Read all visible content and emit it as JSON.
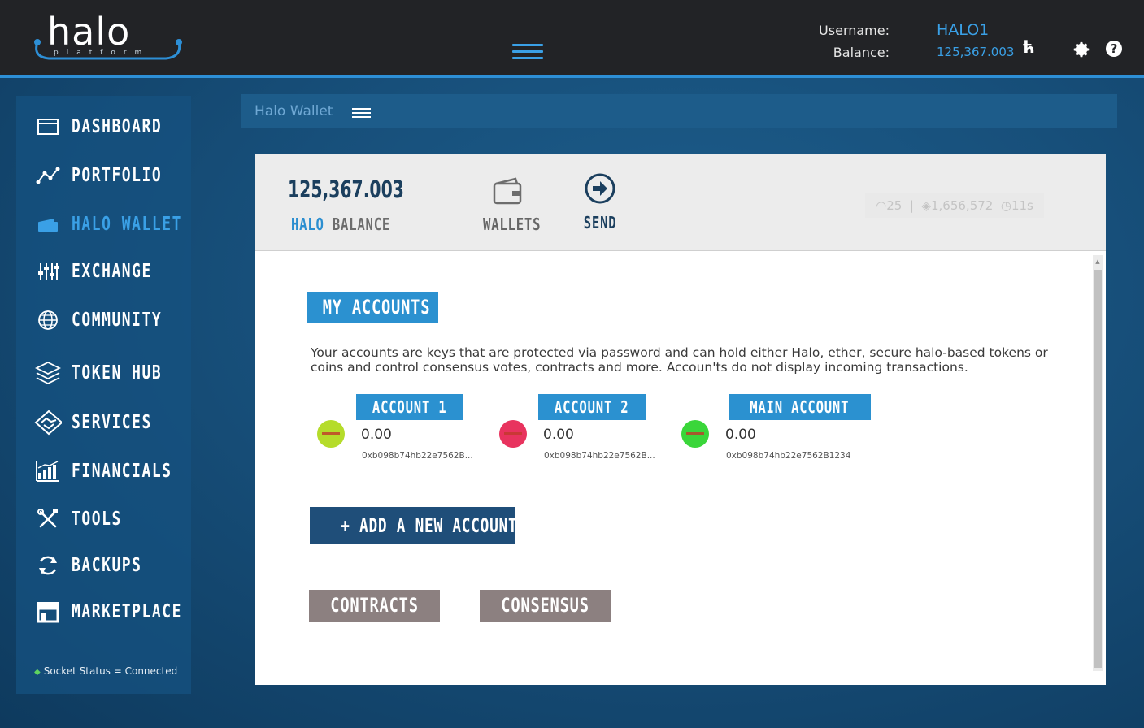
{
  "header": {
    "logo_text": "halo",
    "logo_sub": "platform",
    "username_label": "Username:",
    "balance_label": "Balance:",
    "username": "HALO1",
    "balance": "125,367.003",
    "currency_icon": "ћ"
  },
  "sidebar": {
    "items": [
      {
        "label": "DASHBOARD",
        "icon": "browser-window-icon"
      },
      {
        "label": "PORTFOLIO",
        "icon": "line-chart-icon"
      },
      {
        "label": "HALO WALLET",
        "icon": "wallet-icon"
      },
      {
        "label": "EXCHANGE",
        "icon": "sliders-icon"
      },
      {
        "label": "COMMUNITY",
        "icon": "globe-icon"
      },
      {
        "label": "TOKEN HUB",
        "icon": "layers-icon"
      },
      {
        "label": "SERVICES",
        "icon": "handshake-icon"
      },
      {
        "label": "FINANCIALS",
        "icon": "bar-chart-icon"
      },
      {
        "label": "TOOLS",
        "icon": "tools-icon"
      },
      {
        "label": "BACKUPS",
        "icon": "refresh-icon"
      },
      {
        "label": "MARKETPLACE",
        "icon": "store-icon"
      }
    ],
    "active_index": 2,
    "socket_status": "Socket Status = Connected"
  },
  "breadcrumb": {
    "title": "Halo Wallet"
  },
  "wallet_header": {
    "balance_value": "125,367.003",
    "balance_label_halo": "HALO",
    "balance_label_word": "BALANCE",
    "wallets_label": "WALLETS",
    "send_label": "SEND",
    "stats": {
      "peers": "25",
      "blocks": "1,656,572",
      "time": "11s"
    }
  },
  "accounts_section": {
    "title": "MY ACCOUNTS",
    "description": "Your accounts are keys that are protected via password and can hold either Halo, ether, secure halo-based tokens or coins and control consensus votes, contracts and more. Accoun'ts do not display incoming transactions.",
    "accounts": [
      {
        "name": "ACCOUNT 1",
        "amount": "0.00",
        "address": "0xb098b74hb22e7562B...",
        "color": "#b5dc2a"
      },
      {
        "name": "ACCOUNT 2",
        "amount": "0.00",
        "address": "0xb098b74hb22e7562B...",
        "color": "#e8335e"
      },
      {
        "name": "MAIN ACCOUNT",
        "amount": "0.00",
        "address": "0xb098b74hb22e7562B1234",
        "color": "#3ad63a"
      }
    ],
    "add_button": "+ ADD A NEW ACCOUNT",
    "contracts_button": "CONTRACTS",
    "consensus_button": "CONSENSUS"
  },
  "colors": {
    "accent": "#2b91d0",
    "dark_blue": "#1f4e79",
    "topbar": "#222326",
    "grey_button": "#8c8080"
  }
}
